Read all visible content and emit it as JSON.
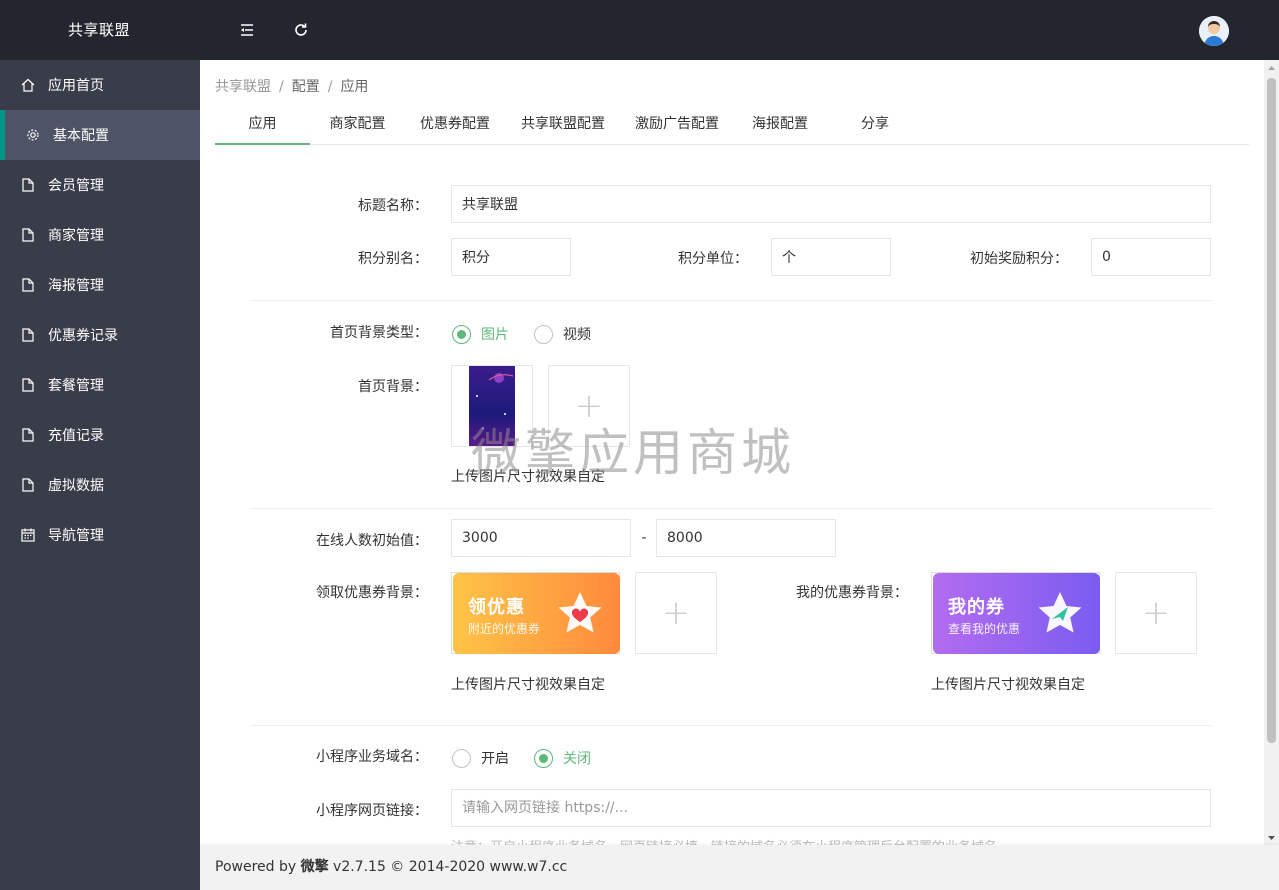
{
  "header": {
    "brand": "共享联盟",
    "menu_toggle_icon": "indent-icon",
    "refresh_icon": "refresh-icon",
    "avatar_icon": "user-avatar"
  },
  "sidebar": {
    "items": [
      {
        "label": "应用首页",
        "icon": "home-icon"
      },
      {
        "label": "基本配置",
        "icon": "gear-icon",
        "active": true
      },
      {
        "label": "会员管理",
        "icon": "file-icon"
      },
      {
        "label": "商家管理",
        "icon": "file-icon"
      },
      {
        "label": "海报管理",
        "icon": "file-icon"
      },
      {
        "label": "优惠券记录",
        "icon": "file-icon"
      },
      {
        "label": "套餐管理",
        "icon": "file-icon"
      },
      {
        "label": "充值记录",
        "icon": "file-icon"
      },
      {
        "label": "虚拟数据",
        "icon": "file-icon"
      },
      {
        "label": "导航管理",
        "icon": "calendar-icon"
      }
    ]
  },
  "breadcrumb": {
    "items": [
      "共享联盟",
      "配置",
      "应用"
    ],
    "separator": "/"
  },
  "tabs": [
    {
      "label": "应用",
      "active": true
    },
    {
      "label": "商家配置"
    },
    {
      "label": "优惠券配置"
    },
    {
      "label": "共享联盟配置"
    },
    {
      "label": "激励广告配置"
    },
    {
      "label": "海报配置"
    },
    {
      "label": "分享"
    }
  ],
  "form": {
    "title_label": "标题名称：",
    "title_value": "共享联盟",
    "points_alias_label": "积分别名：",
    "points_alias_value": "积分",
    "points_unit_label": "积分单位：",
    "points_unit_value": "个",
    "initial_points_label": "初始奖励积分：",
    "initial_points_value": "0",
    "bg_type_label": "首页背景类型：",
    "bg_type_options": [
      "图片",
      "视频"
    ],
    "bg_type_selected": "图片",
    "bg_label": "首页背景：",
    "upload_hint": "上传图片尺寸视效果自定",
    "online_label": "在线人数初始值：",
    "online_min": "3000",
    "online_sep": "-",
    "online_max": "8000",
    "coupon_bg_label": "领取优惠券背景：",
    "coupon_title": "领优惠",
    "coupon_sub": "附近的优惠券",
    "my_coupon_bg_label": "我的优惠券背景：",
    "my_coupon_title": "我的券",
    "my_coupon_sub": "查看我的优惠",
    "domain_label": "小程序业务域名：",
    "domain_options": [
      "开启",
      "关闭"
    ],
    "domain_selected": "关闭",
    "link_label": "小程序网页链接：",
    "link_placeholder": "请输入网页链接 https://...",
    "link_note": "注意：开启小程序业务域名，网页链接必填，链接的域名必须在小程序管理后台配置的业务域名"
  },
  "watermark": "微擎应用商城",
  "footer": {
    "prefix": "Powered by ",
    "brand": "微擎",
    "suffix": " v2.7.15 © 2014-2020 www.w7.cc"
  },
  "colors": {
    "accent": "#5fb878",
    "sidebar_bg": "#393d49",
    "header_bg": "#23262e",
    "active_bar": "#009688"
  }
}
